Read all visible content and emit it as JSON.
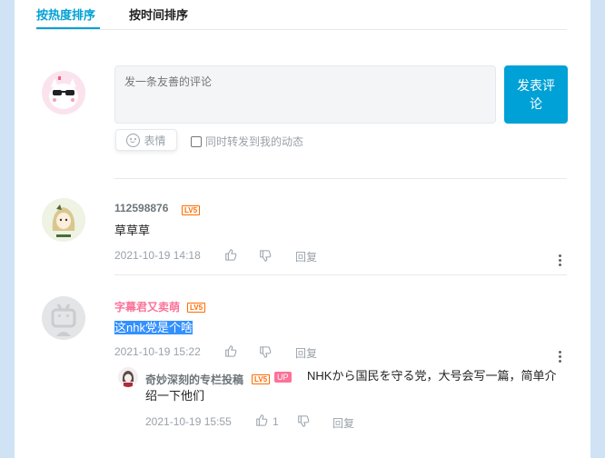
{
  "tabs": [
    {
      "label": "按热度排序",
      "active": true
    },
    {
      "label": "按时间排序",
      "active": false
    }
  ],
  "composer": {
    "placeholder": "发一条友善的评论",
    "post_label": "发表评论",
    "emoji_label": "表情",
    "forward_label": "同时转发到我的动态"
  },
  "comments": [
    {
      "username": "112598876",
      "level": "LV5",
      "content": "草草草",
      "time": "2021-10-19 14:18",
      "reply_label": "回复"
    },
    {
      "username": "字幕君又卖萌",
      "level": "LV5",
      "content": "这nhk党是个啥",
      "time": "2021-10-19 15:22",
      "reply_label": "回复",
      "replies": [
        {
          "username": "奇妙深刻的专栏投稿",
          "level": "LV5",
          "badge": "UP",
          "content": "NHKから国民を守る党，大号会写一篇，简单介绍一下他们",
          "time": "2021-10-19 15:55",
          "likes": "1",
          "reply_label": "回复"
        }
      ]
    }
  ],
  "colors": {
    "accent": "#00a1d6",
    "vip_name": "#fb7299",
    "level": "#ff6c00",
    "meta": "#99a2aa"
  }
}
